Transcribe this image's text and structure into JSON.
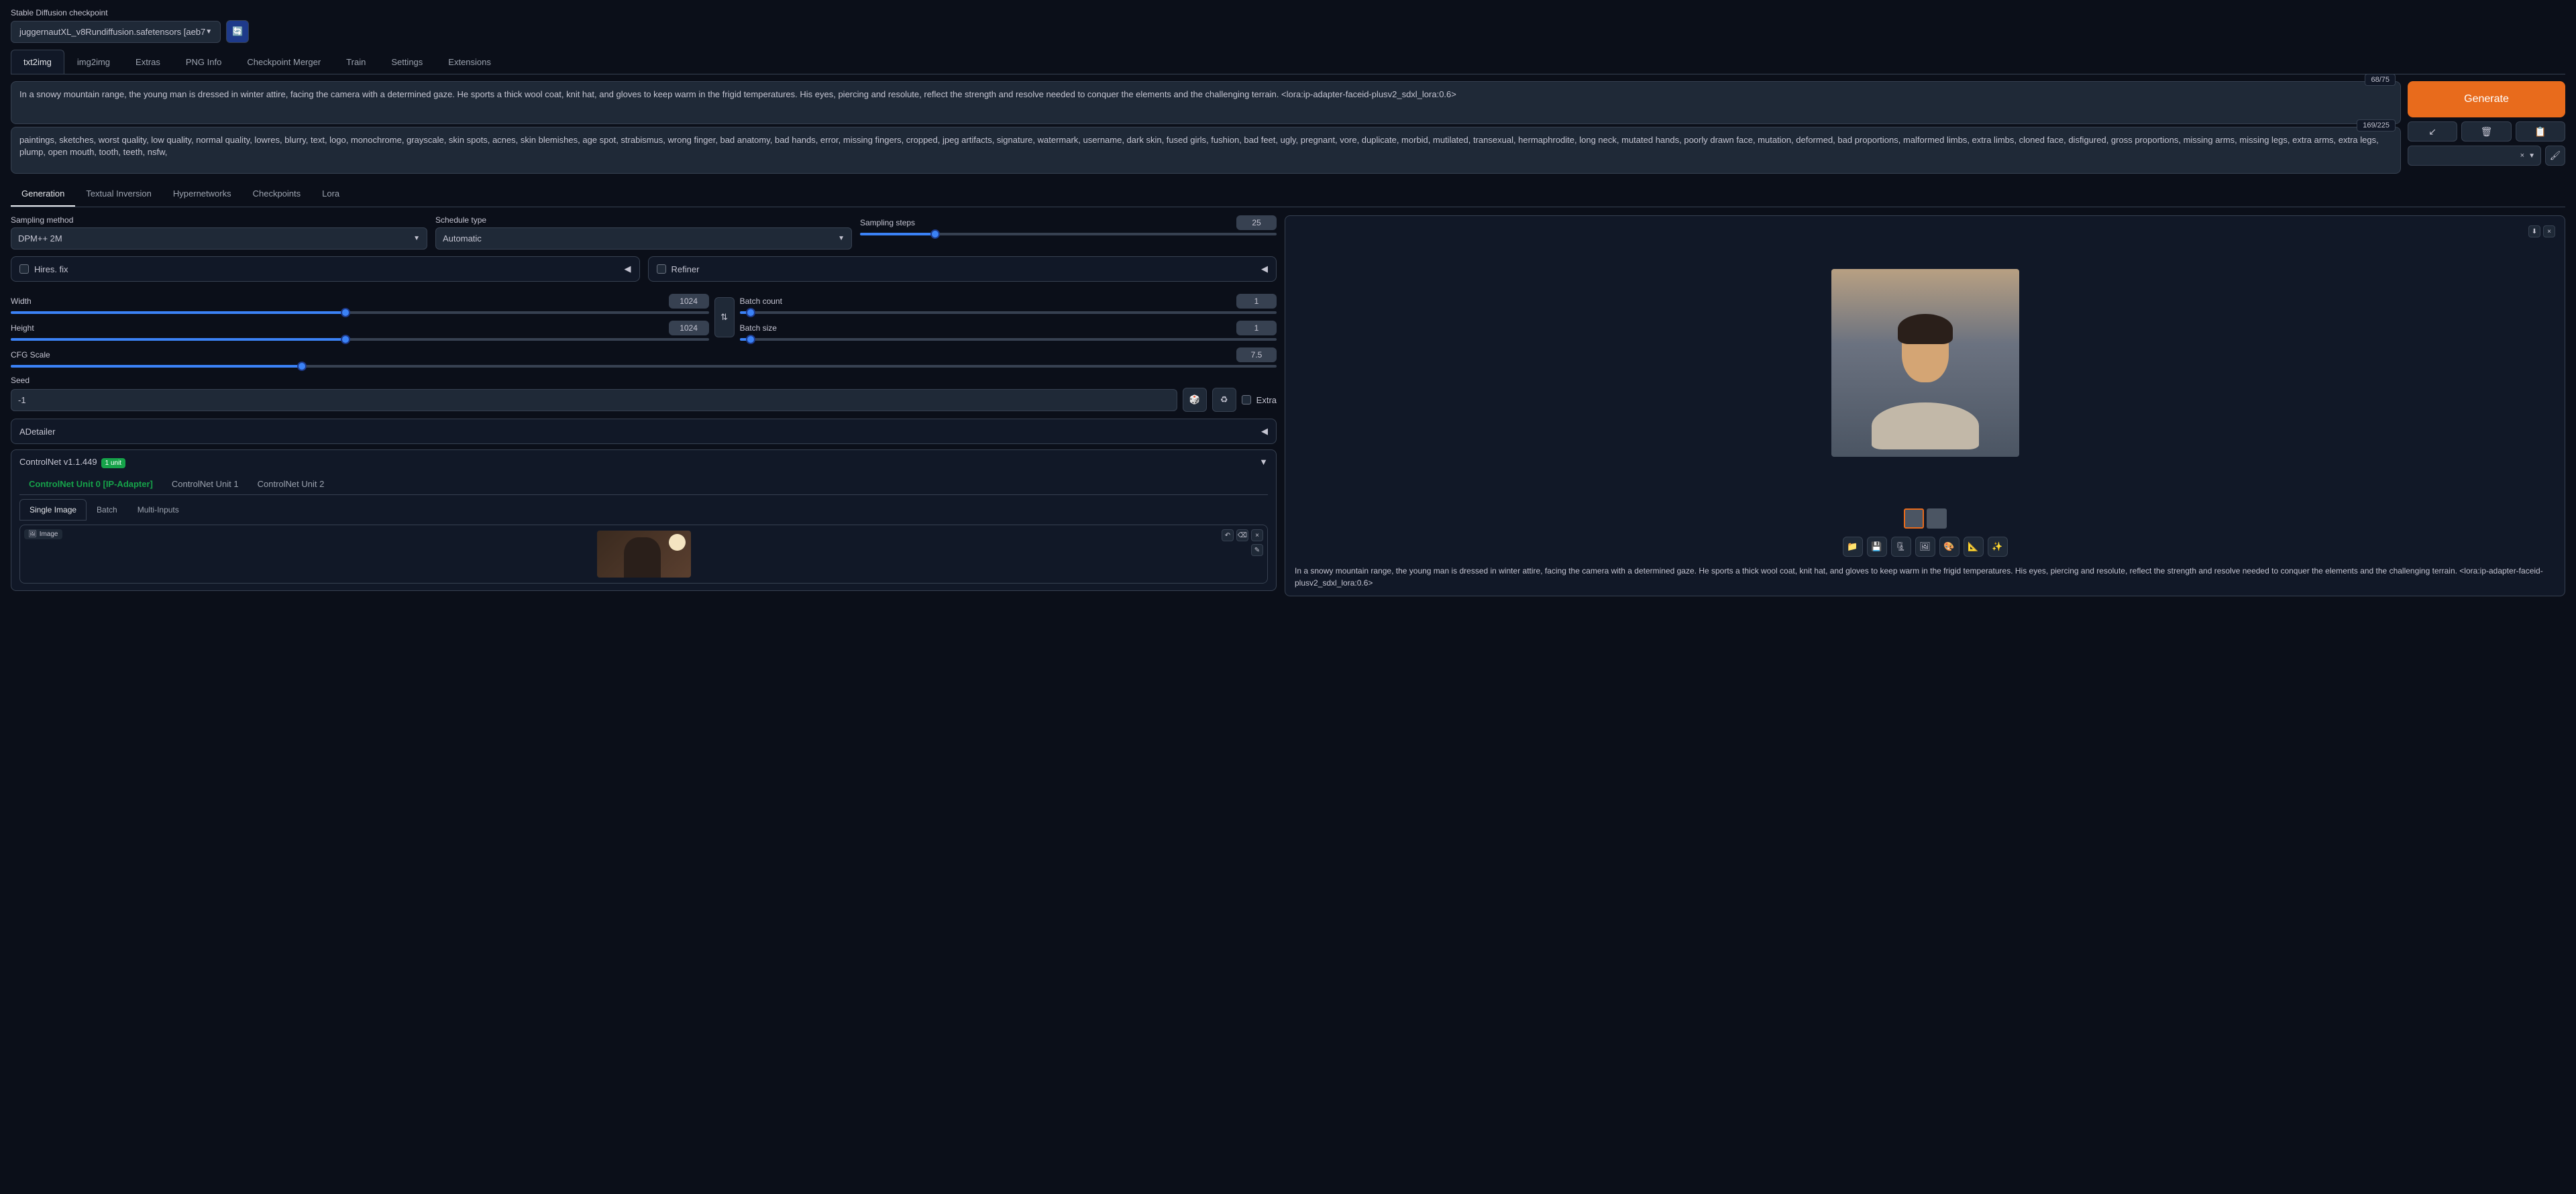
{
  "header": {
    "label": "Stable Diffusion checkpoint",
    "checkpoint": "juggernautXL_v8Rundiffusion.safetensors [aeb7"
  },
  "main_tabs": [
    "txt2img",
    "img2img",
    "Extras",
    "PNG Info",
    "Checkpoint Merger",
    "Train",
    "Settings",
    "Extensions"
  ],
  "prompt": {
    "counter": "68/75",
    "text": "In a snowy mountain range, the young man is dressed in winter attire, facing the camera with a determined gaze. He sports a thick wool coat, knit hat, and gloves to keep warm in the frigid temperatures. His eyes, piercing and resolute, reflect the strength and resolve needed to conquer the elements and the challenging terrain. <lora:ip-adapter-faceid-plusv2_sdxl_lora:0.6>"
  },
  "neg_prompt": {
    "counter": "169/225",
    "text": "paintings, sketches, worst quality, low quality, normal quality, lowres, blurry, text, logo, monochrome, grayscale, skin spots, acnes, skin blemishes, age spot, strabismus, wrong finger, bad anatomy, bad hands, error, missing fingers, cropped, jpeg artifacts, signature, watermark, username, dark skin, fused girls, fushion, bad feet, ugly, pregnant, vore, duplicate, morbid, mutilated, transexual, hermaphrodite, long neck, mutated hands, poorly drawn face, mutation, deformed, bad proportions, malformed limbs, extra limbs, cloned face, disfigured, gross proportions, missing arms, missing legs, extra arms, extra legs, plump, open mouth, tooth, teeth, nsfw,"
  },
  "generate": "Generate",
  "gen_subtabs": [
    "Generation",
    "Textual Inversion",
    "Hypernetworks",
    "Checkpoints",
    "Lora"
  ],
  "params": {
    "sampling_method": {
      "label": "Sampling method",
      "value": "DPM++ 2M"
    },
    "schedule_type": {
      "label": "Schedule type",
      "value": "Automatic"
    },
    "sampling_steps": {
      "label": "Sampling steps",
      "value": "25"
    },
    "hires_fix": "Hires. fix",
    "refiner": "Refiner",
    "width": {
      "label": "Width",
      "value": "1024"
    },
    "height": {
      "label": "Height",
      "value": "1024"
    },
    "batch_count": {
      "label": "Batch count",
      "value": "1"
    },
    "batch_size": {
      "label": "Batch size",
      "value": "1"
    },
    "cfg": {
      "label": "CFG Scale",
      "value": "7.5"
    },
    "seed": {
      "label": "Seed",
      "value": "-1"
    },
    "extra": "Extra"
  },
  "accordions": {
    "adetailer": "ADetailer",
    "controlnet": {
      "label": "ControlNet v1.1.449",
      "badge": "1 unit"
    }
  },
  "cn_tabs": [
    "ControlNet Unit 0 [IP-Adapter]",
    "ControlNet Unit 1",
    "ControlNet Unit 2"
  ],
  "cn_subtabs": [
    "Single Image",
    "Batch",
    "Multi-Inputs"
  ],
  "cn_image_label": "Image",
  "output": {
    "caption": "In a snowy mountain range, the young man is dressed in winter attire, facing the camera with a determined gaze. He sports a thick wool coat, knit hat, and gloves to keep warm in the frigid temperatures. His eyes, piercing and resolute, reflect the strength and resolve needed to conquer the elements and the challenging terrain. <lora:ip-adapter-faceid-plusv2_sdxl_lora:0.6>"
  }
}
